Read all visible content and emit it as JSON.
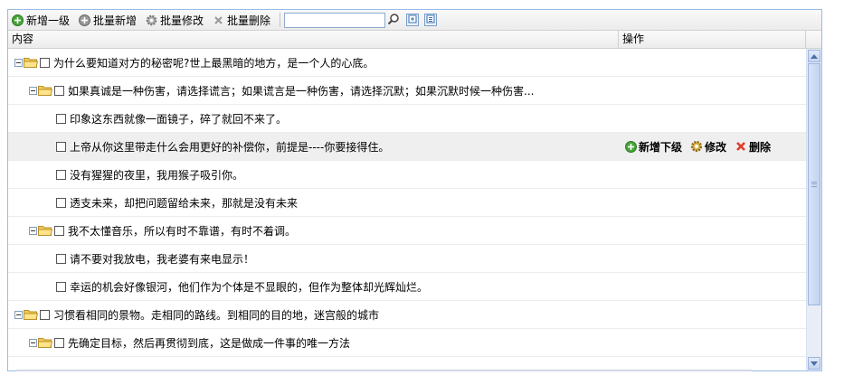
{
  "toolbar": {
    "add_root": "新增一级",
    "batch_add": "批量新增",
    "batch_edit": "批量修改",
    "batch_delete": "批量删除",
    "search_value": "",
    "search_placeholder": ""
  },
  "columns": {
    "content": "内容",
    "ops": "操作"
  },
  "ops_labels": {
    "add_child": "新增下级",
    "edit": "修改",
    "delete": "删除"
  },
  "rows": [
    {
      "level": 0,
      "has_children": true,
      "text": "为什么要知道对方的秘密呢?世上最黑暗的地方，是一个人的心底。"
    },
    {
      "level": 1,
      "has_children": true,
      "text": "如果真诚是一种伤害，请选择谎言；如果谎言是一种伤害，请选择沉默；如果沉默时候一种伤害..."
    },
    {
      "level": 2,
      "has_children": false,
      "text": "印象这东西就像一面镜子，碎了就回不来了。"
    },
    {
      "level": 2,
      "has_children": false,
      "text": "上帝从你这里带走什么会用更好的补偿你，前提是----你要接得住。",
      "highlighted": true
    },
    {
      "level": 2,
      "has_children": false,
      "text": "没有猩猩的夜里，我用猴子吸引你。"
    },
    {
      "level": 2,
      "has_children": false,
      "text": "透支未来，却把问题留给未来，那就是没有未来"
    },
    {
      "level": 1,
      "has_children": true,
      "text": "我不太懂音乐，所以有时不靠谱，有时不着调。"
    },
    {
      "level": 2,
      "has_children": false,
      "text": "请不要对我放电，我老婆有来电显示！"
    },
    {
      "level": 2,
      "has_children": false,
      "text": "幸运的机会好像银河，他们作为个体是不显眼的，但作为整体却光辉灿烂。"
    },
    {
      "level": 0,
      "has_children": true,
      "text": "习惯看相同的景物。走相同的路线。到相同的目的地，迷宫般的城市"
    },
    {
      "level": 1,
      "has_children": true,
      "text": "先确定目标，然后再贯彻到底，这是做成一件事的唯一方法"
    }
  ],
  "colors": {
    "border": "#99bbe8",
    "add_green": "#3a9a2a",
    "delete_red": "#e23b2a",
    "folder": "#f2cc52"
  }
}
